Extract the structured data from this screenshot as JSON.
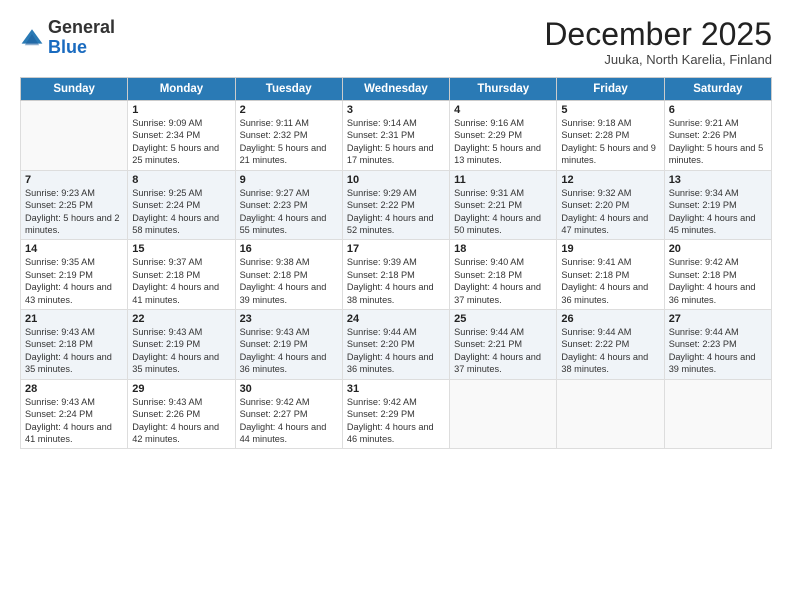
{
  "header": {
    "logo_general": "General",
    "logo_blue": "Blue",
    "month": "December 2025",
    "location": "Juuka, North Karelia, Finland"
  },
  "days_of_week": [
    "Sunday",
    "Monday",
    "Tuesday",
    "Wednesday",
    "Thursday",
    "Friday",
    "Saturday"
  ],
  "weeks": [
    [
      {
        "day": "",
        "sunrise": "",
        "sunset": "",
        "daylight": ""
      },
      {
        "day": "1",
        "sunrise": "Sunrise: 9:09 AM",
        "sunset": "Sunset: 2:34 PM",
        "daylight": "Daylight: 5 hours and 25 minutes."
      },
      {
        "day": "2",
        "sunrise": "Sunrise: 9:11 AM",
        "sunset": "Sunset: 2:32 PM",
        "daylight": "Daylight: 5 hours and 21 minutes."
      },
      {
        "day": "3",
        "sunrise": "Sunrise: 9:14 AM",
        "sunset": "Sunset: 2:31 PM",
        "daylight": "Daylight: 5 hours and 17 minutes."
      },
      {
        "day": "4",
        "sunrise": "Sunrise: 9:16 AM",
        "sunset": "Sunset: 2:29 PM",
        "daylight": "Daylight: 5 hours and 13 minutes."
      },
      {
        "day": "5",
        "sunrise": "Sunrise: 9:18 AM",
        "sunset": "Sunset: 2:28 PM",
        "daylight": "Daylight: 5 hours and 9 minutes."
      },
      {
        "day": "6",
        "sunrise": "Sunrise: 9:21 AM",
        "sunset": "Sunset: 2:26 PM",
        "daylight": "Daylight: 5 hours and 5 minutes."
      }
    ],
    [
      {
        "day": "7",
        "sunrise": "Sunrise: 9:23 AM",
        "sunset": "Sunset: 2:25 PM",
        "daylight": "Daylight: 5 hours and 2 minutes."
      },
      {
        "day": "8",
        "sunrise": "Sunrise: 9:25 AM",
        "sunset": "Sunset: 2:24 PM",
        "daylight": "Daylight: 4 hours and 58 minutes."
      },
      {
        "day": "9",
        "sunrise": "Sunrise: 9:27 AM",
        "sunset": "Sunset: 2:23 PM",
        "daylight": "Daylight: 4 hours and 55 minutes."
      },
      {
        "day": "10",
        "sunrise": "Sunrise: 9:29 AM",
        "sunset": "Sunset: 2:22 PM",
        "daylight": "Daylight: 4 hours and 52 minutes."
      },
      {
        "day": "11",
        "sunrise": "Sunrise: 9:31 AM",
        "sunset": "Sunset: 2:21 PM",
        "daylight": "Daylight: 4 hours and 50 minutes."
      },
      {
        "day": "12",
        "sunrise": "Sunrise: 9:32 AM",
        "sunset": "Sunset: 2:20 PM",
        "daylight": "Daylight: 4 hours and 47 minutes."
      },
      {
        "day": "13",
        "sunrise": "Sunrise: 9:34 AM",
        "sunset": "Sunset: 2:19 PM",
        "daylight": "Daylight: 4 hours and 45 minutes."
      }
    ],
    [
      {
        "day": "14",
        "sunrise": "Sunrise: 9:35 AM",
        "sunset": "Sunset: 2:19 PM",
        "daylight": "Daylight: 4 hours and 43 minutes."
      },
      {
        "day": "15",
        "sunrise": "Sunrise: 9:37 AM",
        "sunset": "Sunset: 2:18 PM",
        "daylight": "Daylight: 4 hours and 41 minutes."
      },
      {
        "day": "16",
        "sunrise": "Sunrise: 9:38 AM",
        "sunset": "Sunset: 2:18 PM",
        "daylight": "Daylight: 4 hours and 39 minutes."
      },
      {
        "day": "17",
        "sunrise": "Sunrise: 9:39 AM",
        "sunset": "Sunset: 2:18 PM",
        "daylight": "Daylight: 4 hours and 38 minutes."
      },
      {
        "day": "18",
        "sunrise": "Sunrise: 9:40 AM",
        "sunset": "Sunset: 2:18 PM",
        "daylight": "Daylight: 4 hours and 37 minutes."
      },
      {
        "day": "19",
        "sunrise": "Sunrise: 9:41 AM",
        "sunset": "Sunset: 2:18 PM",
        "daylight": "Daylight: 4 hours and 36 minutes."
      },
      {
        "day": "20",
        "sunrise": "Sunrise: 9:42 AM",
        "sunset": "Sunset: 2:18 PM",
        "daylight": "Daylight: 4 hours and 36 minutes."
      }
    ],
    [
      {
        "day": "21",
        "sunrise": "Sunrise: 9:43 AM",
        "sunset": "Sunset: 2:18 PM",
        "daylight": "Daylight: 4 hours and 35 minutes."
      },
      {
        "day": "22",
        "sunrise": "Sunrise: 9:43 AM",
        "sunset": "Sunset: 2:19 PM",
        "daylight": "Daylight: 4 hours and 35 minutes."
      },
      {
        "day": "23",
        "sunrise": "Sunrise: 9:43 AM",
        "sunset": "Sunset: 2:19 PM",
        "daylight": "Daylight: 4 hours and 36 minutes."
      },
      {
        "day": "24",
        "sunrise": "Sunrise: 9:44 AM",
        "sunset": "Sunset: 2:20 PM",
        "daylight": "Daylight: 4 hours and 36 minutes."
      },
      {
        "day": "25",
        "sunrise": "Sunrise: 9:44 AM",
        "sunset": "Sunset: 2:21 PM",
        "daylight": "Daylight: 4 hours and 37 minutes."
      },
      {
        "day": "26",
        "sunrise": "Sunrise: 9:44 AM",
        "sunset": "Sunset: 2:22 PM",
        "daylight": "Daylight: 4 hours and 38 minutes."
      },
      {
        "day": "27",
        "sunrise": "Sunrise: 9:44 AM",
        "sunset": "Sunset: 2:23 PM",
        "daylight": "Daylight: 4 hours and 39 minutes."
      }
    ],
    [
      {
        "day": "28",
        "sunrise": "Sunrise: 9:43 AM",
        "sunset": "Sunset: 2:24 PM",
        "daylight": "Daylight: 4 hours and 41 minutes."
      },
      {
        "day": "29",
        "sunrise": "Sunrise: 9:43 AM",
        "sunset": "Sunset: 2:26 PM",
        "daylight": "Daylight: 4 hours and 42 minutes."
      },
      {
        "day": "30",
        "sunrise": "Sunrise: 9:42 AM",
        "sunset": "Sunset: 2:27 PM",
        "daylight": "Daylight: 4 hours and 44 minutes."
      },
      {
        "day": "31",
        "sunrise": "Sunrise: 9:42 AM",
        "sunset": "Sunset: 2:29 PM",
        "daylight": "Daylight: 4 hours and 46 minutes."
      },
      {
        "day": "",
        "sunrise": "",
        "sunset": "",
        "daylight": ""
      },
      {
        "day": "",
        "sunrise": "",
        "sunset": "",
        "daylight": ""
      },
      {
        "day": "",
        "sunrise": "",
        "sunset": "",
        "daylight": ""
      }
    ]
  ]
}
